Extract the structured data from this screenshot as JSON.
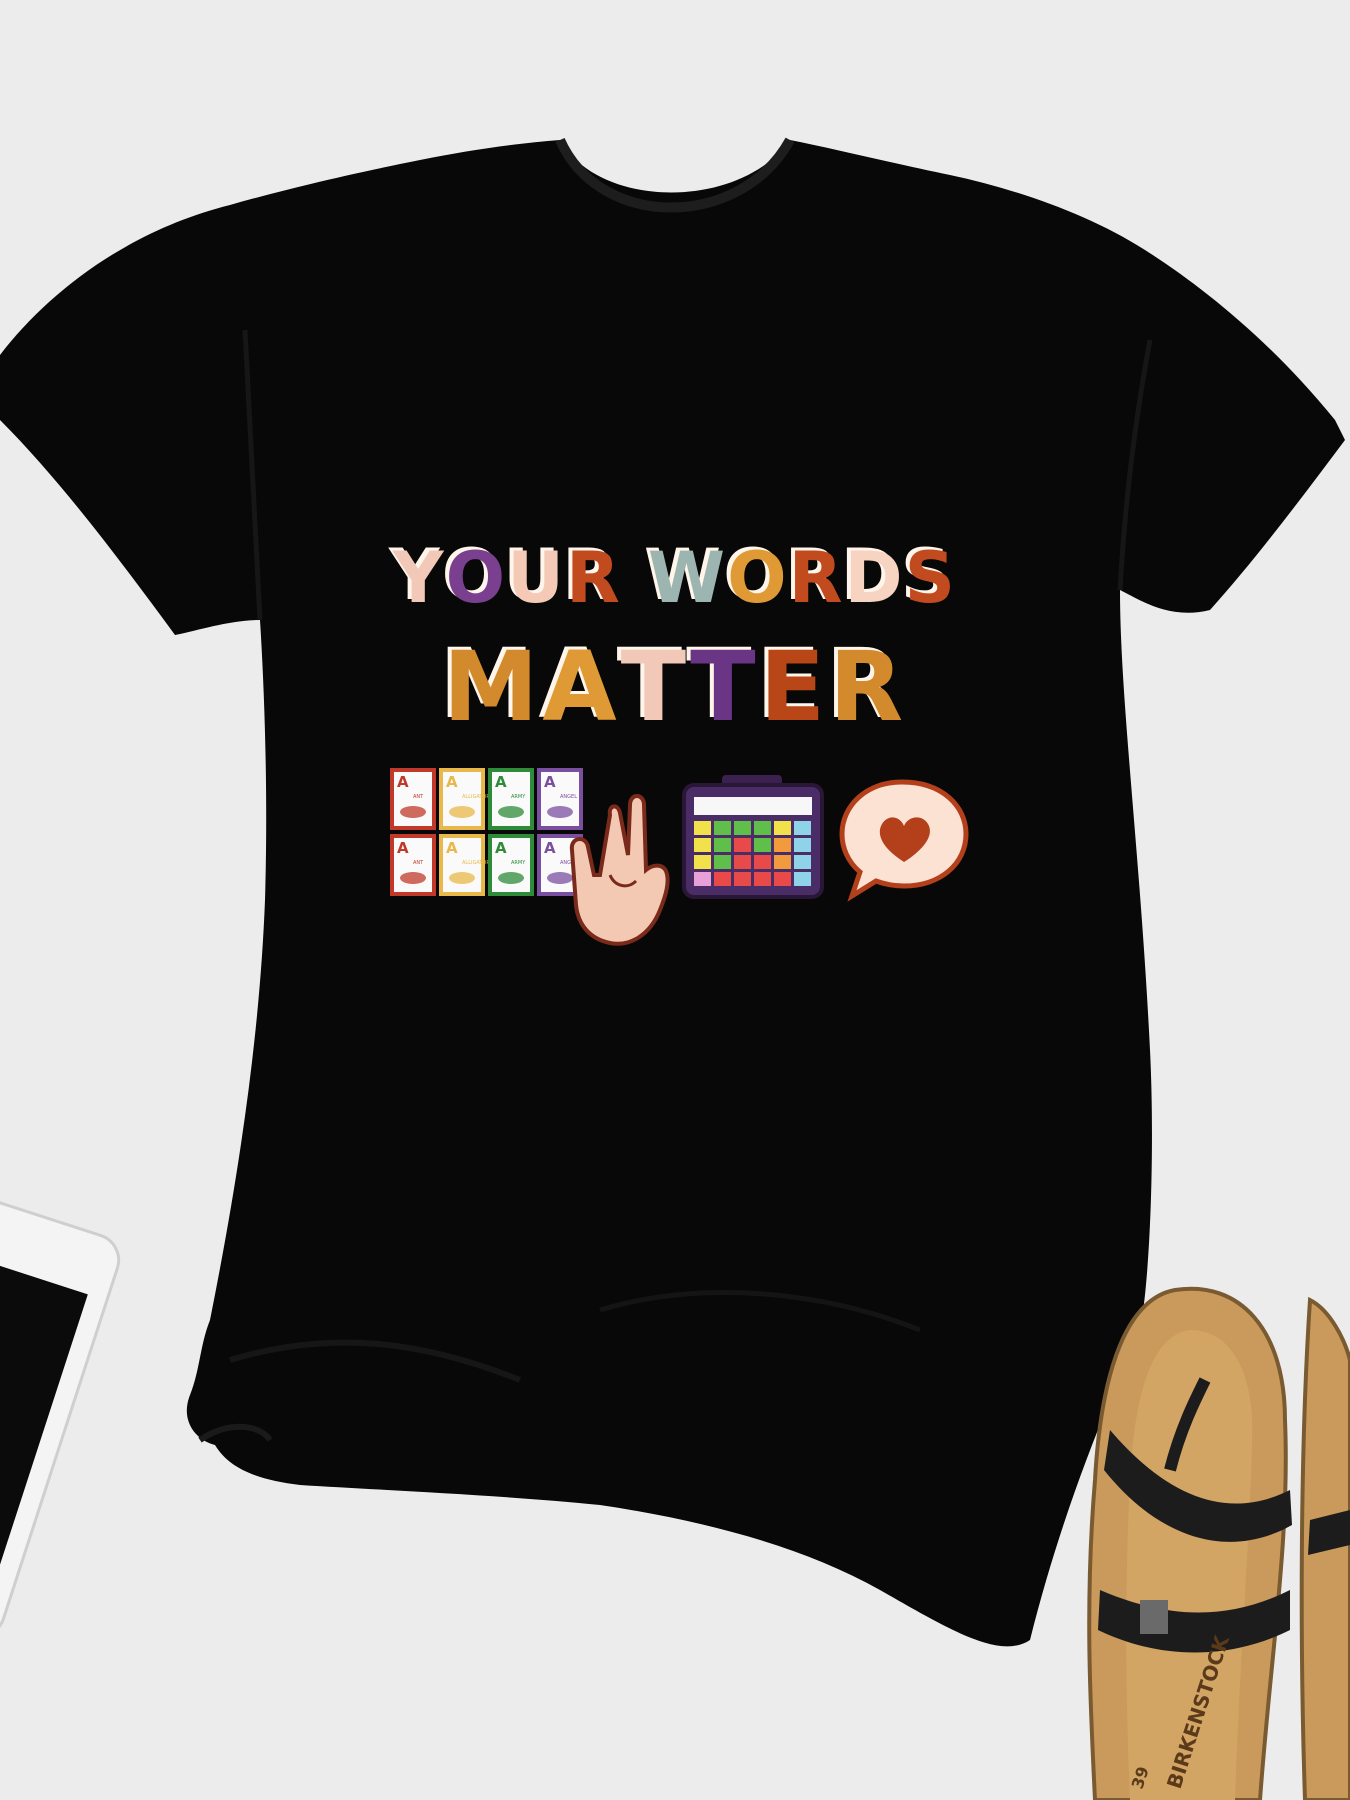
{
  "print": {
    "line1": [
      "Y",
      "O",
      "U",
      "R",
      " ",
      "W",
      "O",
      "R",
      "D",
      "S"
    ],
    "line1_colors": [
      "#f2c9b8",
      "#7a3f8f",
      "#f4c9b6",
      "#c24a1f",
      "#000000",
      "#9db5b0",
      "#e09a35",
      "#c24a1f",
      "#f7d3c2",
      "#c24a1f"
    ],
    "line2": [
      "M",
      "A",
      "T",
      "T",
      "E",
      "R"
    ],
    "line2_colors": [
      "#d28a2c",
      "#e09a35",
      "#f2c9b8",
      "#6a3585",
      "#b84616",
      "#d28a2c"
    ],
    "cards_row1": [
      "ANT",
      "ALLIGATOR",
      "ARMY",
      "ANGEL"
    ],
    "cards_row2": [
      "ANT",
      "ALLIGATOR",
      "ARMY",
      "ANGEL"
    ],
    "card_letter": "A",
    "card_colors": [
      "#c0392b",
      "#e8b84a",
      "#2e8b3a",
      "#7a4fa0"
    ]
  },
  "sandal": {
    "brand_text": "BIRKENSTOCK",
    "size_text": "39"
  },
  "colors": {
    "background": "#ececec",
    "shirt": "#080808",
    "sandal_cork": "#c99a5c",
    "sandal_strap": "#1c1c1c"
  },
  "icons": [
    "vocabulary-cards-icon",
    "sign-language-hand-icon",
    "communication-device-icon",
    "heart-speech-bubble-icon",
    "smartphone-icon",
    "sandal-icon"
  ]
}
